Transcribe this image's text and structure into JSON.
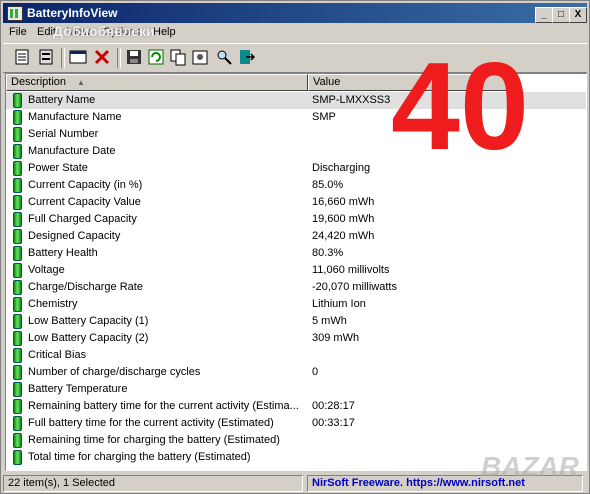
{
  "window": {
    "title": "BatteryInfoView",
    "controls": [
      "_",
      "□",
      "X"
    ]
  },
  "overlay": {
    "big_number": "40",
    "watermark_top": "Добиобявлеки",
    "watermark_corner": "BAZAR"
  },
  "menu": [
    "File",
    "Edit",
    "View",
    "Options",
    "Help"
  ],
  "toolbar_icons": [
    "properties-icon",
    "battery-log-icon",
    "html-report-icon",
    "delete-icon",
    "save-icon",
    "refresh-icon",
    "copy-icon",
    "options-icon",
    "find-icon",
    "exit-icon"
  ],
  "columns": {
    "description": "Description",
    "value": "Value"
  },
  "rows": [
    {
      "d": "Battery Name",
      "v": "SMP-LMXXSS3"
    },
    {
      "d": "Manufacture Name",
      "v": "SMP"
    },
    {
      "d": "Serial Number",
      "v": ""
    },
    {
      "d": "Manufacture Date",
      "v": ""
    },
    {
      "d": "Power State",
      "v": "Discharging"
    },
    {
      "d": "Current Capacity (in %)",
      "v": "85.0%"
    },
    {
      "d": "Current Capacity Value",
      "v": "16,660 mWh"
    },
    {
      "d": "Full Charged Capacity",
      "v": "19,600 mWh"
    },
    {
      "d": "Designed Capacity",
      "v": "24,420 mWh"
    },
    {
      "d": "Battery Health",
      "v": "80.3%"
    },
    {
      "d": "Voltage",
      "v": "11,060 millivolts"
    },
    {
      "d": "Charge/Discharge Rate",
      "v": "-20,070 milliwatts"
    },
    {
      "d": "Chemistry",
      "v": "Lithium Ion"
    },
    {
      "d": "Low Battery Capacity (1)",
      "v": "5 mWh"
    },
    {
      "d": "Low Battery Capacity (2)",
      "v": "309 mWh"
    },
    {
      "d": "Critical Bias",
      "v": ""
    },
    {
      "d": "Number of charge/discharge cycles",
      "v": "0"
    },
    {
      "d": "Battery Temperature",
      "v": ""
    },
    {
      "d": "Remaining battery time for the current activity (Estima...",
      "v": "00:28:17"
    },
    {
      "d": "Full battery time for the current activity (Estimated)",
      "v": "00:33:17"
    },
    {
      "d": "Remaining time for charging the battery (Estimated)",
      "v": ""
    },
    {
      "d": "Total  time for charging the battery (Estimated)",
      "v": ""
    }
  ],
  "status": {
    "items": "22 item(s), 1 Selected",
    "credit": "NirSoft Freeware.  https://www.nirsoft.net"
  }
}
